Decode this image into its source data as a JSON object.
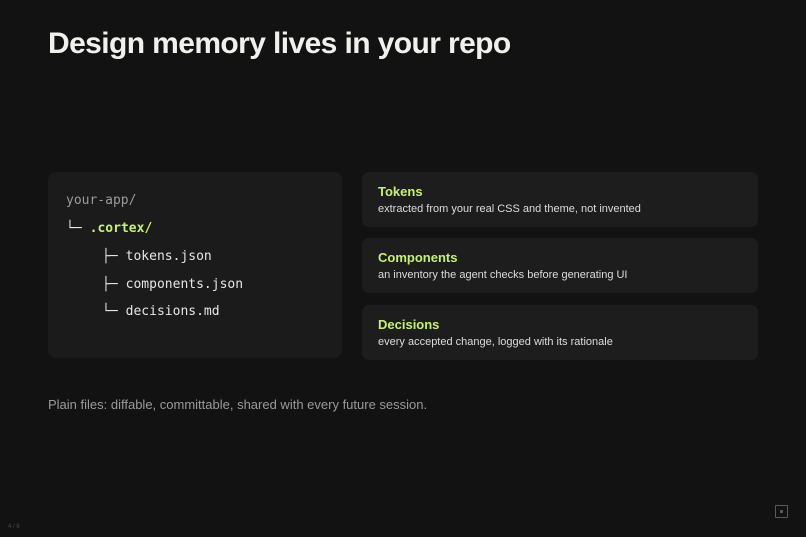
{
  "slide": {
    "title": "Design memory lives in your repo",
    "caption": "Plain files: diffable, committable, shared with every future session.",
    "page_indicator": "4 / 6"
  },
  "tree": {
    "root": "your-app/",
    "cortex_branch": "└─",
    "cortex_dir": ".cortex/",
    "files": [
      {
        "branch": "├─",
        "name": "tokens.json"
      },
      {
        "branch": "├─",
        "name": "components.json"
      },
      {
        "branch": "└─",
        "name": "decisions.md"
      }
    ]
  },
  "cards": [
    {
      "title": "Tokens",
      "description": "extracted from your real CSS and theme, not invented"
    },
    {
      "title": "Components",
      "description": "an inventory the agent checks before generating UI"
    },
    {
      "title": "Decisions",
      "description": "every accepted change, logged with its rationale"
    }
  ],
  "colors": {
    "background": "#121212",
    "panel": "#1b1b1b",
    "accent": "#c6f36a",
    "muted": "#9a9a9a"
  },
  "icons": {
    "fullscreen": "fullscreen-icon"
  }
}
